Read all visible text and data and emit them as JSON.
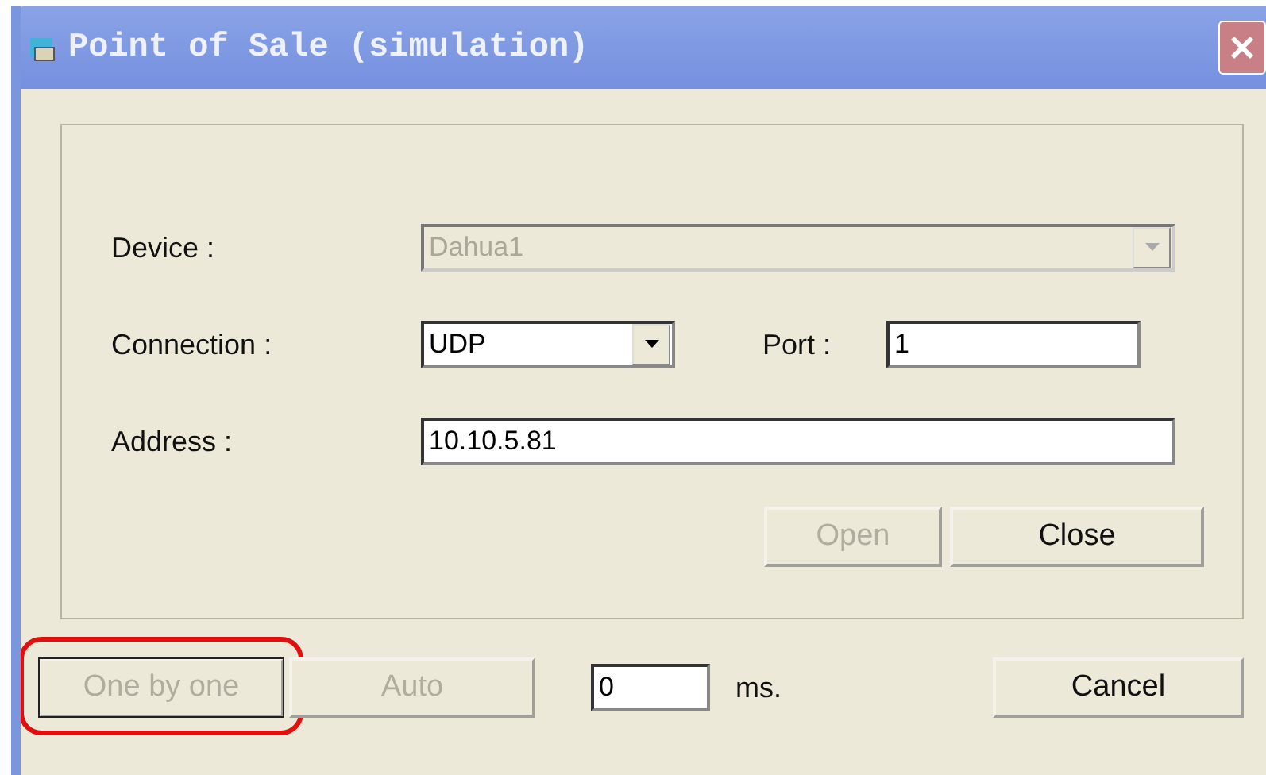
{
  "window": {
    "title": "Point of Sale (simulation)"
  },
  "fields": [
    {
      "kind": "combo",
      "label": "Device :",
      "value": "Dahua1",
      "disabled": true
    },
    {
      "kind": "combo",
      "label": "Connection :",
      "value": "UDP",
      "disabled": false,
      "extra": {
        "label": "Port :",
        "value": "1"
      }
    },
    {
      "kind": "text",
      "label": "Address :",
      "value": "10.10.5.81",
      "disabled": false
    }
  ],
  "connect_buttons": [
    {
      "label": "Open",
      "disabled": true
    },
    {
      "label": "Close",
      "disabled": false
    }
  ],
  "footer": {
    "buttons": [
      {
        "label": "One by one",
        "disabled": true,
        "highlighted": true
      },
      {
        "label": "Auto",
        "disabled": true,
        "highlighted": false
      }
    ],
    "interval": {
      "value": "0",
      "unit": "ms."
    },
    "cancel": {
      "label": "Cancel",
      "disabled": false
    }
  }
}
